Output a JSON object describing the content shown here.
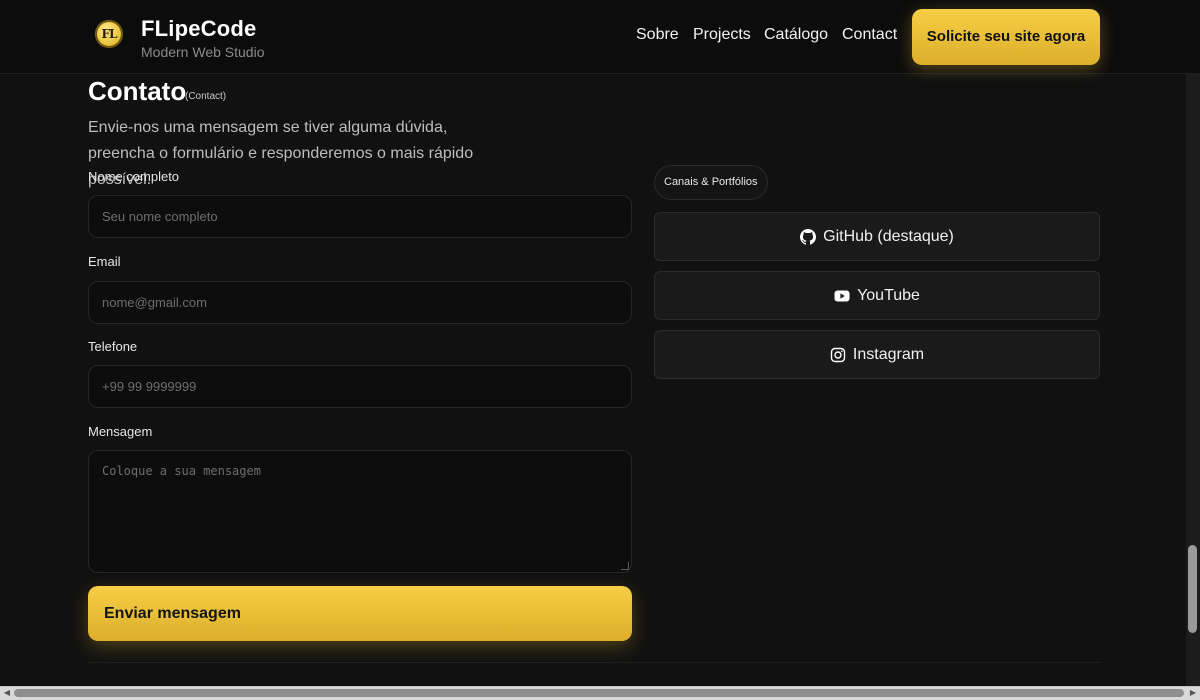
{
  "header": {
    "logo_text": "FL",
    "brand_name": "FLipeCode",
    "brand_tagline": "Modern Web Studio",
    "nav": [
      "Sobre",
      "Projects",
      "Catálogo",
      "Contact"
    ],
    "cta_label": "Solicite seu site agora"
  },
  "contact": {
    "title": "Contato",
    "title_sub": "(Contact)",
    "description": "Envie-nos uma mensagem se tiver alguma dúvida, preencha o formulário e responderemos o mais rápido possível.",
    "fields": {
      "name": {
        "label": "Nome completo",
        "placeholder": "Seu nome completo"
      },
      "email": {
        "label": "Email",
        "placeholder": "nome@gmail.com"
      },
      "phone": {
        "label": "Telefone",
        "placeholder": "+99 99 9999999"
      },
      "message": {
        "label": "Mensagem",
        "placeholder": "Coloque a sua mensagem"
      }
    },
    "submit_label": "Enviar mensagem"
  },
  "channels": {
    "chip_label": "Canais & Portfólios",
    "links": [
      {
        "label": "GitHub (destaque)",
        "icon": "github-icon"
      },
      {
        "label": "YouTube",
        "icon": "youtube-icon"
      },
      {
        "label": "Instagram",
        "icon": "instagram-icon"
      }
    ]
  },
  "colors": {
    "background": "#111111",
    "accent": "#f2c43d",
    "card": "#1a1a1a"
  }
}
